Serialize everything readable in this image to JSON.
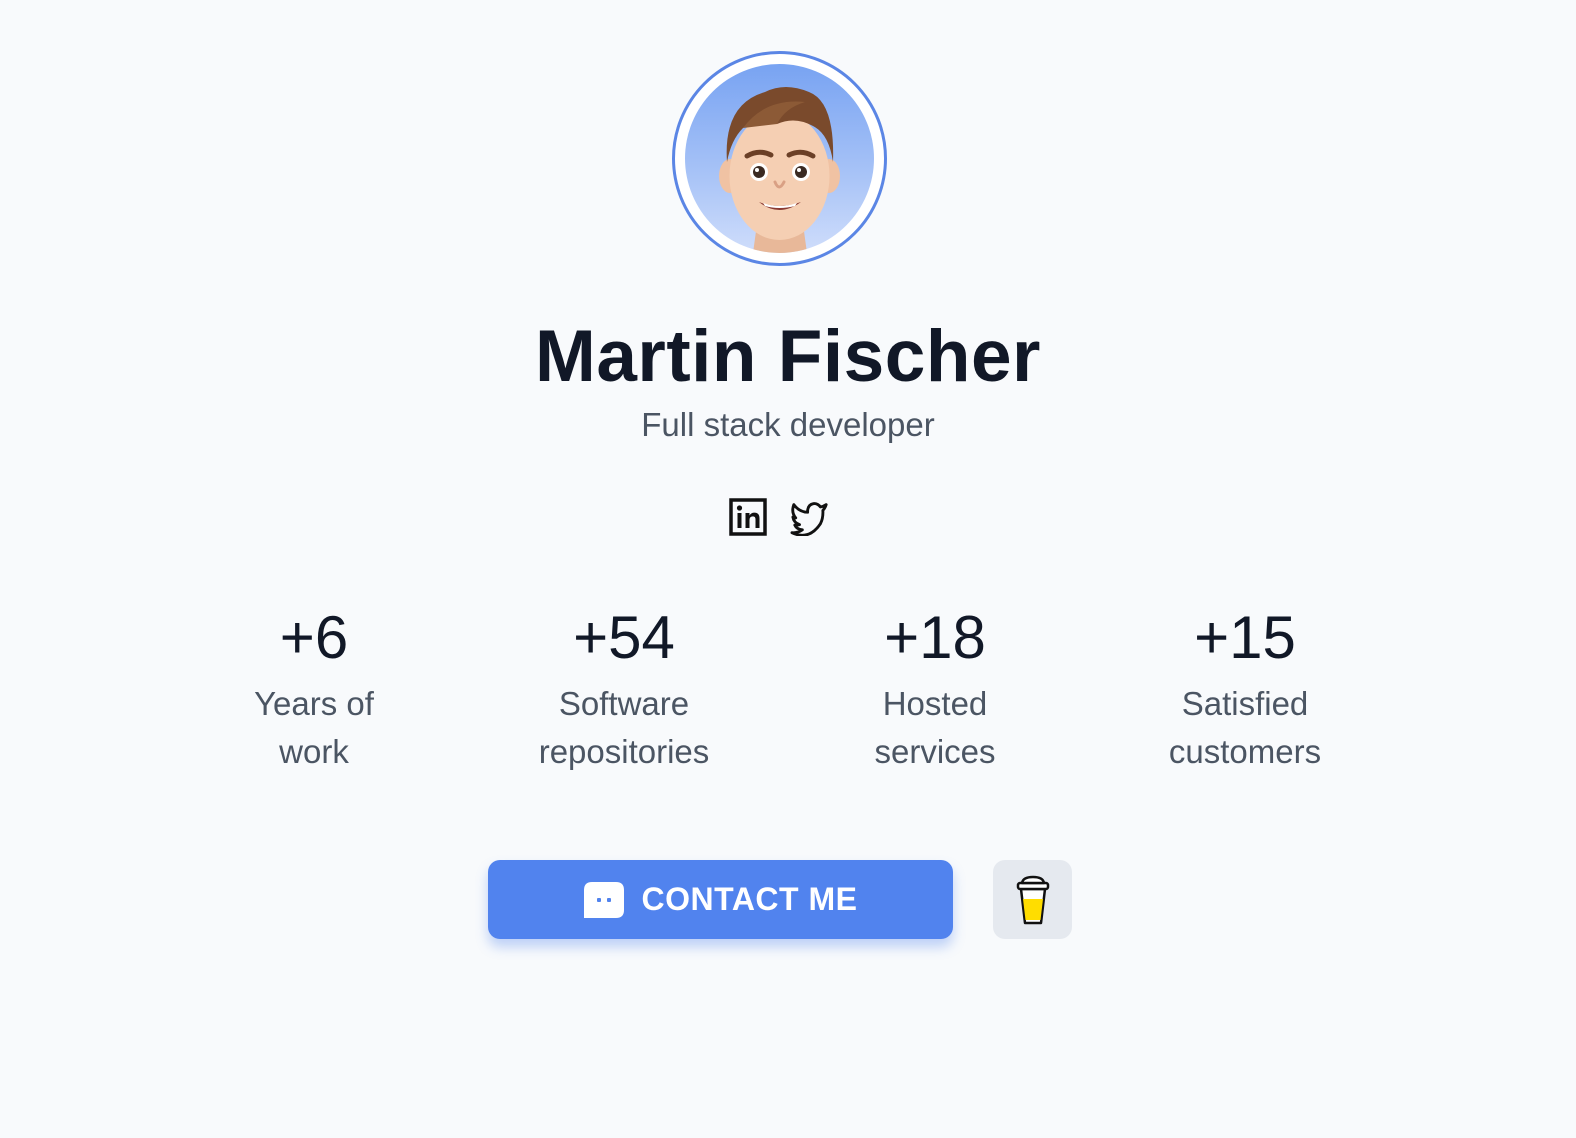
{
  "profile": {
    "name": "Martin Fischer",
    "role": "Full stack developer",
    "avatar_icon": "memoji-avatar",
    "accent_color": "#5183ee"
  },
  "socials": [
    {
      "icon": "linkedin-icon"
    },
    {
      "icon": "twitter-icon"
    }
  ],
  "stats": [
    {
      "value": "+6",
      "label": "Years of work"
    },
    {
      "value": "+54",
      "label": "Software repositories"
    },
    {
      "value": "+18",
      "label": "Hosted services"
    },
    {
      "value": "+15",
      "label": "Satisfied customers"
    }
  ],
  "actions": {
    "contact_label": "CONTACT ME",
    "contact_icon": "chat-icon",
    "coffee_icon": "coffee-cup-icon"
  }
}
